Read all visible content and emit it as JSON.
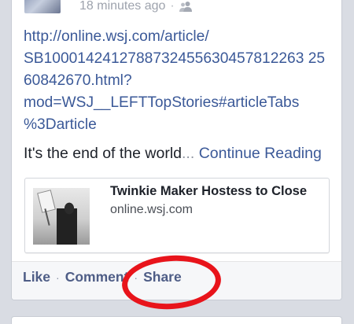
{
  "post": {
    "timestamp": "18 minutes ago",
    "separator": "·",
    "audience_icon": "people-icon",
    "link_lines": [
      "http://online.wsj.com/article/",
      "SB1000142412788732455630457812263 25",
      "60842670.html?",
      "mod=WSJ__LEFTTopStories#articleTabs",
      "%3Darticle"
    ],
    "text": "It's the end of the world",
    "ellipsis": "...",
    "continue_label": "Continue Reading"
  },
  "preview": {
    "title": "Twinkie Maker Hostess to Close",
    "domain": "online.wsj.com"
  },
  "actions": {
    "like": "Like",
    "comment": "Comment",
    "share": "Share",
    "separator": "·"
  },
  "colors": {
    "link": "#3b5998",
    "action": "#4e5d86",
    "highlight": "#e8141b"
  }
}
